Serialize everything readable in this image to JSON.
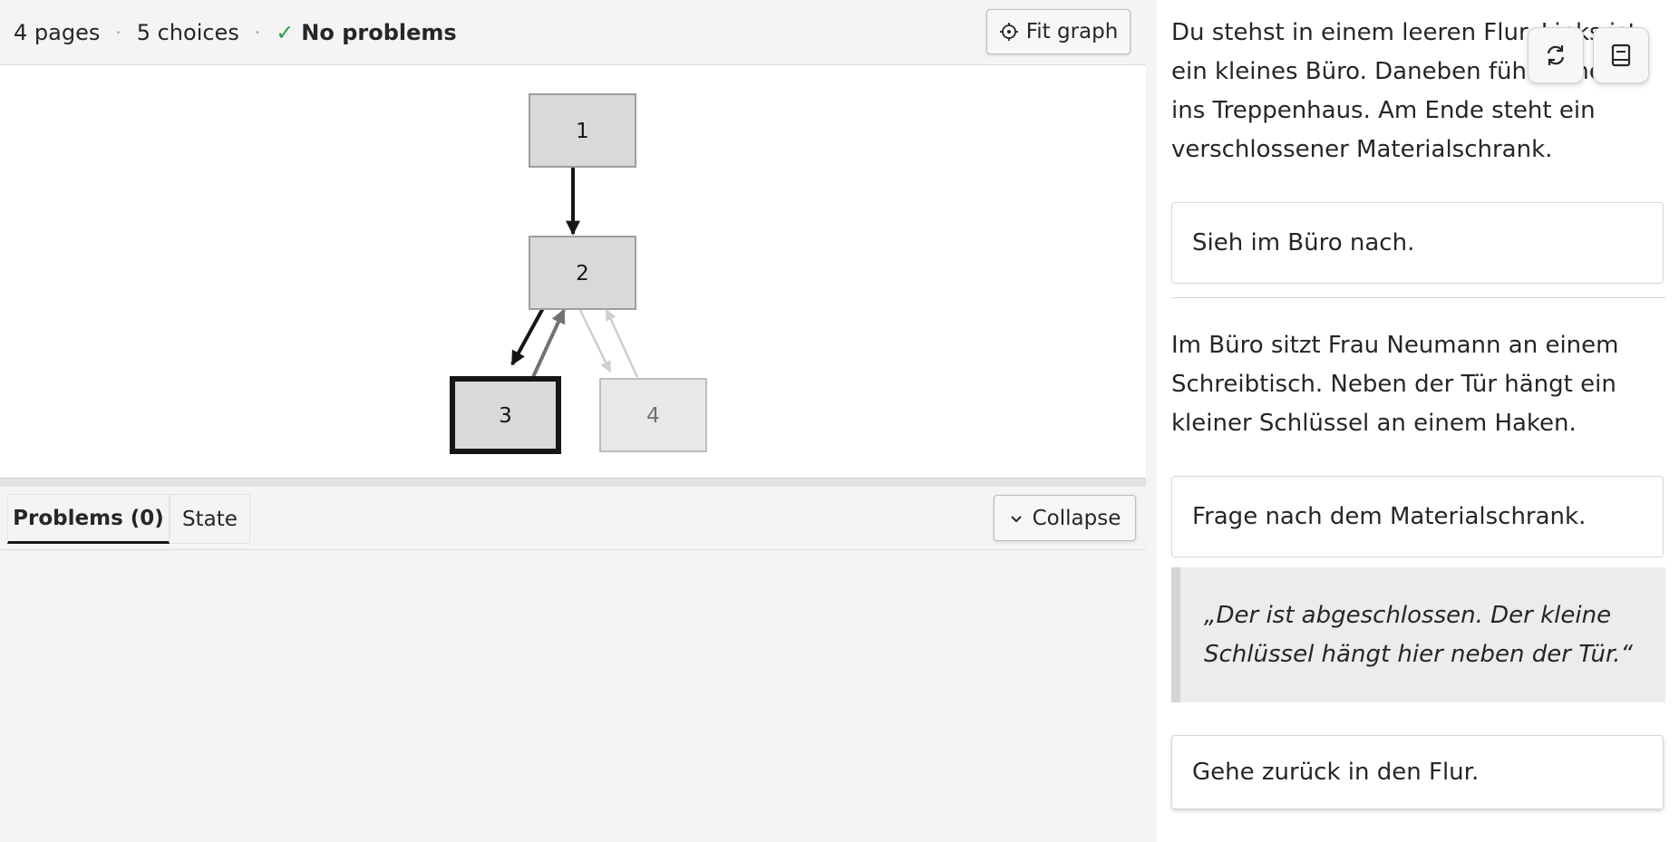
{
  "stats": {
    "pages": "4 pages",
    "choices": "5 choices",
    "separator": "·",
    "problems_status": "No problems",
    "check_glyph": "✓"
  },
  "toolbar": {
    "fit_graph_label": "Fit graph",
    "fit_icon": "crosshair-icon"
  },
  "graph": {
    "nodes": [
      {
        "id": "1",
        "label": "1",
        "state": "visited"
      },
      {
        "id": "2",
        "label": "2",
        "state": "visited"
      },
      {
        "id": "3",
        "label": "3",
        "state": "current"
      },
      {
        "id": "4",
        "label": "4",
        "state": "unvisited"
      }
    ],
    "edges": [
      {
        "from": "1",
        "to": "2",
        "style": "taken"
      },
      {
        "from": "2",
        "to": "3",
        "style": "taken"
      },
      {
        "from": "3",
        "to": "2",
        "style": "available"
      },
      {
        "from": "2",
        "to": "4",
        "style": "unvisited"
      },
      {
        "from": "4",
        "to": "2",
        "style": "unvisited"
      }
    ],
    "colors": {
      "visited_fill": "#d9d9d9",
      "unvisited_fill": "#e8e8e8",
      "taken_edge": "#161616",
      "available_edge": "#6f7378",
      "unvisited_edge": "#cfcfcf"
    }
  },
  "panel": {
    "tabs": [
      {
        "label": "Problems (0)",
        "active": true
      },
      {
        "label": "State",
        "active": false
      }
    ],
    "collapse_label": "Collapse",
    "collapse_icon": "chevron-down-icon"
  },
  "story": {
    "passage1": "Du stehst in einem leeren Flur. Links ist ein kleines Büro. Daneben führt eine Tür ins Treppenhaus. Am Ende steht ein verschlossener Materialschrank.",
    "choice1": "Sieh im Büro nach.",
    "passage2": "Im Büro sitzt Frau Neumann an einem Schreibtisch. Neben der Tür hängt ein kleiner Schlüssel an einem Haken.",
    "choice2": "Frage nach dem Materialschrank.",
    "quote": "„Der ist abgeschlossen. Der kleine Schlüssel hängt hier neben der Tür.“",
    "choice3": "Gehe zurück in den Flur.",
    "restart_icon": "restart-icon",
    "details_icon": "book-icon"
  }
}
